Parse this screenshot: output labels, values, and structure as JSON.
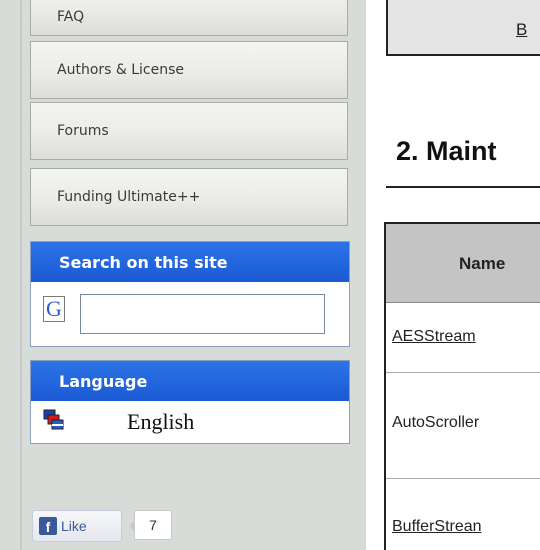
{
  "sidebar": {
    "nav": [
      {
        "label": "FAQ"
      },
      {
        "label": "Authors & License"
      },
      {
        "label": "Forums"
      },
      {
        "label": "Funding Ultimate++"
      }
    ],
    "search_box": {
      "title": "Search on this site",
      "input_value": ""
    },
    "language_box": {
      "title": "Language",
      "selected": "English"
    },
    "facebook": {
      "like_label": "Like",
      "like_count": "7"
    }
  },
  "main": {
    "top_link_fragment": "B",
    "section_heading": "2. Maint",
    "table": {
      "header": "Name",
      "rows": [
        {
          "name": "AESStream",
          "is_link": true
        },
        {
          "name": "AutoScroller",
          "is_link": false
        },
        {
          "name": "BufferStrean",
          "is_link": true
        }
      ]
    }
  }
}
